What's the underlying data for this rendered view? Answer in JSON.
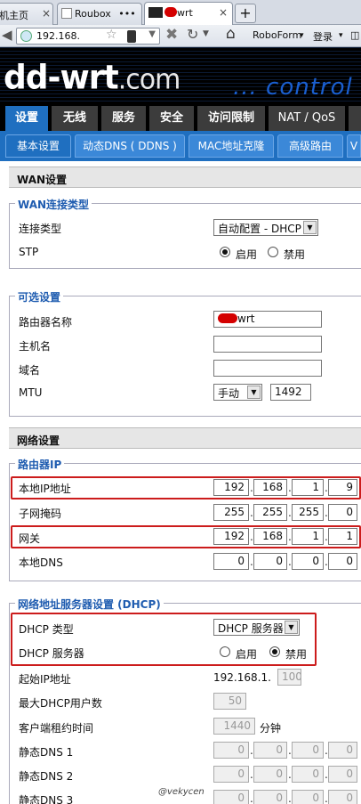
{
  "browser": {
    "tabs": [
      {
        "label": "机主页"
      },
      {
        "label": "Roubox"
      },
      {
        "label": "wrt"
      }
    ],
    "tab_overflow": "•••",
    "close_glyph": "×",
    "new_tab_glyph": "+",
    "url": "192.168.",
    "roboform": "RoboForm",
    "login": "登录"
  },
  "brand": {
    "logo_main": "dd-wrt",
    "logo_suffix": ".com",
    "tagline": "... control p"
  },
  "main_tabs": [
    "设置",
    "无线",
    "服务",
    "安全",
    "访问限制",
    "NAT / QoS"
  ],
  "sub_tabs": [
    "基本设置",
    "动态DNS ( DDNS )",
    "MAC地址克隆",
    "高级路由",
    "V"
  ],
  "wan": {
    "heading": "WAN设置",
    "conn_legend": "WAN连接类型",
    "conn_type_label": "连接类型",
    "conn_type_value": "自动配置 - DHCP",
    "stp_label": "STP",
    "stp_on": "启用",
    "stp_off": "禁用",
    "stp_selected": "启用"
  },
  "optional": {
    "legend": "可选设置",
    "router_name_label": "路由器名称",
    "router_name_value": "wrt",
    "hostname_label": "主机名",
    "hostname_value": "",
    "domain_label": "域名",
    "domain_value": "",
    "mtu_label": "MTU",
    "mtu_mode": "手动",
    "mtu_value": "1492"
  },
  "network": {
    "heading": "网络设置",
    "router_ip_legend": "路由器IP",
    "local_ip_label": "本地IP地址",
    "local_ip": [
      "192",
      "168",
      "1",
      "9"
    ],
    "subnet_label": "子网掩码",
    "subnet": [
      "255",
      "255",
      "255",
      "0"
    ],
    "gateway_label": "网关",
    "gateway": [
      "192",
      "168",
      "1",
      "1"
    ],
    "dns_label": "本地DNS",
    "dns": [
      "0",
      "0",
      "0",
      "0"
    ]
  },
  "dhcp": {
    "legend": "网络地址服务器设置 (DHCP)",
    "type_label": "DHCP 类型",
    "type_value": "DHCP 服务器",
    "server_label": "DHCP 服务器",
    "server_on": "启用",
    "server_off": "禁用",
    "server_selected": "禁用",
    "start_ip_label": "起始IP地址",
    "start_ip_prefix": "192.168.1.",
    "start_ip_last": "100",
    "max_users_label": "最大DHCP用户数",
    "max_users": "50",
    "lease_label": "客户端租约时间",
    "lease_value": "1440",
    "lease_unit": "分钟",
    "dns1_label": "静态DNS 1",
    "dns1": [
      "0",
      "0",
      "0",
      "0"
    ],
    "dns2_label": "静态DNS 2",
    "dns2": [
      "0",
      "0",
      "0",
      "0"
    ],
    "dns3_label": "静态DNS 3",
    "dns3": [
      "0",
      "0",
      "0",
      "0"
    ]
  },
  "watermark": "@vekycen",
  "colors": {
    "accent": "#1f6fc0",
    "highlight": "#cc1c1c",
    "legend_text": "#1f5cb0"
  }
}
